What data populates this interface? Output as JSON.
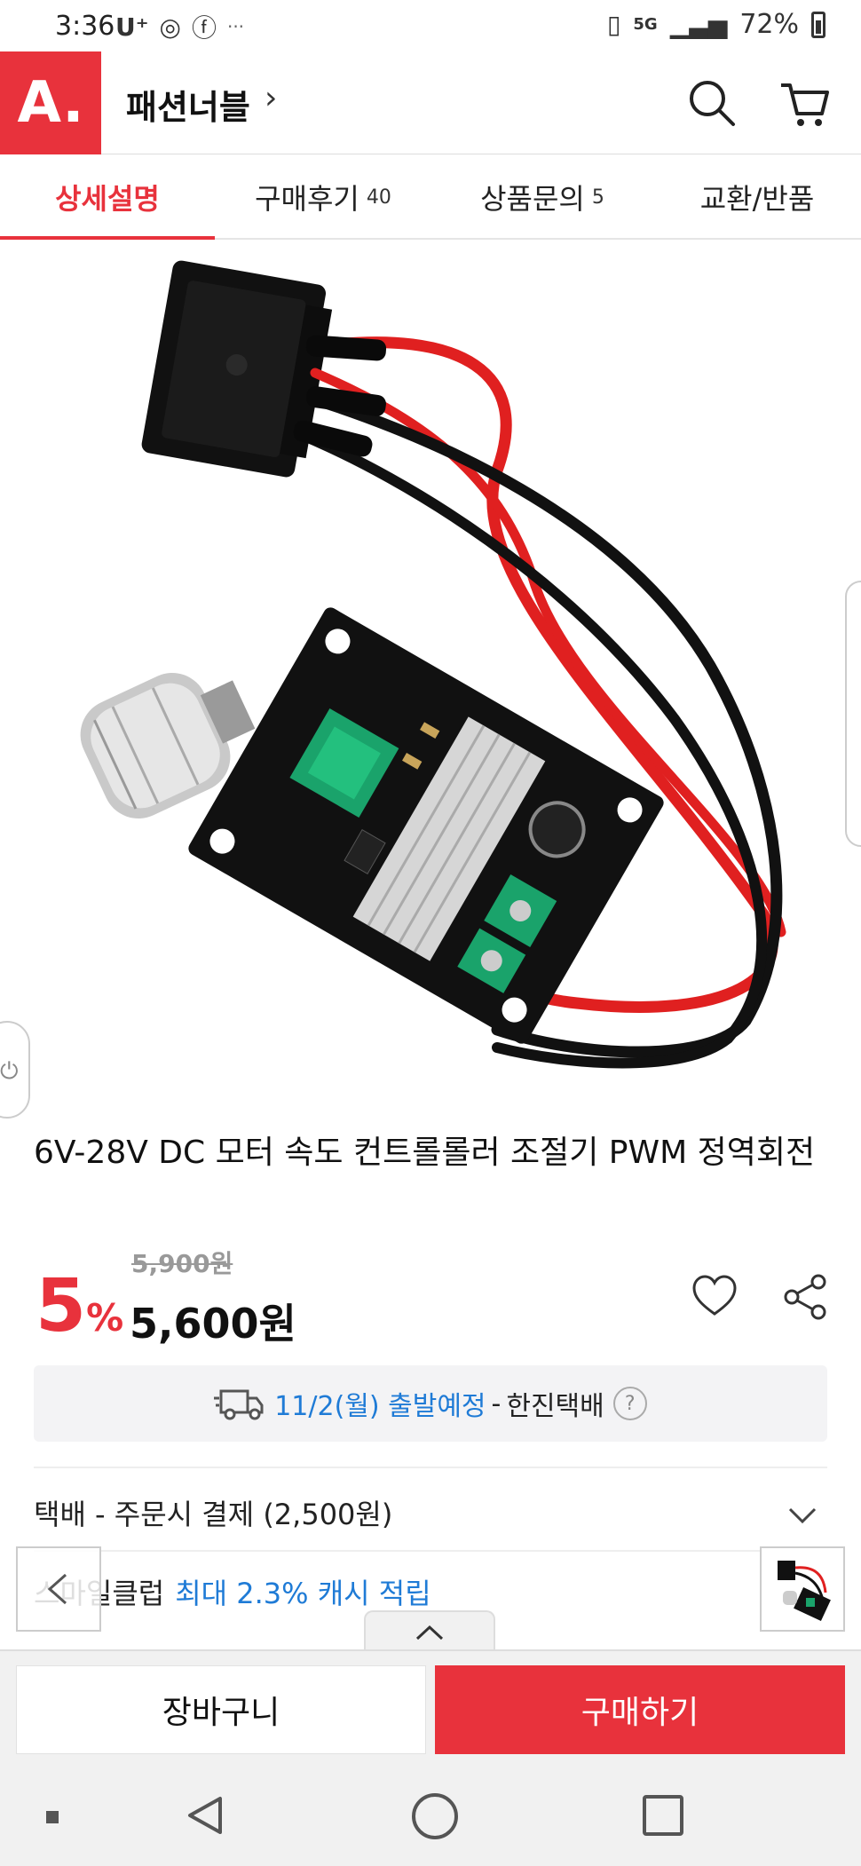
{
  "status_bar": {
    "time": "3:36",
    "carrier": "U⁺",
    "network": "5G",
    "battery_percent": "72%",
    "overflow": "···"
  },
  "header": {
    "logo_text": "A.",
    "store_name": "패션너블",
    "store_chevron": "›"
  },
  "tabs": [
    {
      "label": "상세설명",
      "count": ""
    },
    {
      "label": "구매후기",
      "count": "40"
    },
    {
      "label": "상품문의",
      "count": "5"
    },
    {
      "label": "교환/반품",
      "count": ""
    }
  ],
  "product": {
    "title": "6V-28V DC 모터 속도 컨트롤롤러 조절기 PWM 정역회전",
    "original_price": "5,900원",
    "discount": "5",
    "discount_unit": "%",
    "price": "5,600원"
  },
  "delivery": {
    "date_text": "11/2(월) 출발예정",
    "separator": "-",
    "carrier": "한진택배",
    "help": "?"
  },
  "shipping": {
    "text": "택배 - 주문시 결제 (2,500원)"
  },
  "smile_club": {
    "label": "스마일클럽",
    "highlight": "최대 2.3% 캐시 적립"
  },
  "bottom_bar": {
    "cart_label": "장바구니",
    "buy_label": "구매하기"
  },
  "colors": {
    "brand_red": "#e8323c",
    "link_blue": "#1f7bd6",
    "wire_red": "#e02020",
    "pcb_black": "#111111",
    "pot_green": "#1aa36b"
  }
}
